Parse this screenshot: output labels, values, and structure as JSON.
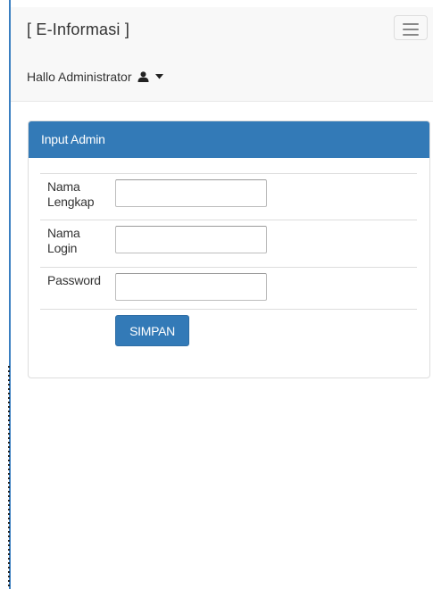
{
  "navbar": {
    "brand": "[ E-Informasi ]",
    "user_greeting": "Hallo Administrator",
    "user_icon": "user-icon",
    "caret_icon": "caret-down-icon",
    "menu_toggle_icon": "hamburger-icon"
  },
  "panel": {
    "title": "Input Admin",
    "fields": [
      {
        "label_line1": "Nama",
        "label_line2": "Lengkap",
        "value": "",
        "placeholder": ""
      },
      {
        "label_line1": "Nama",
        "label_line2": "Login",
        "value": "",
        "placeholder": ""
      },
      {
        "label_line1": "Password",
        "label_line2": "",
        "value": "",
        "placeholder": ""
      }
    ],
    "save_label": "SIMPAN"
  },
  "colors": {
    "primary": "#337ab7",
    "navbar_bg": "#f8f8f8",
    "text": "#333333"
  }
}
